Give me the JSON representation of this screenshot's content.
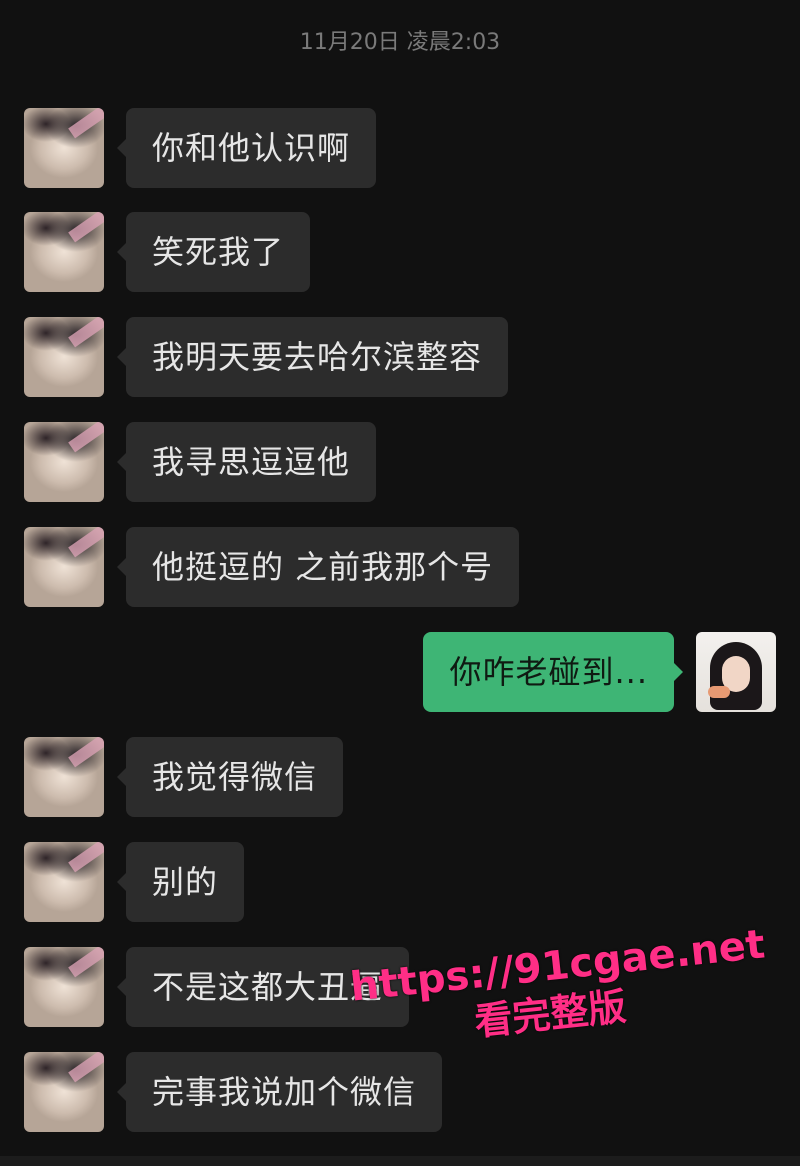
{
  "header": {
    "timestamp": "11月20日 凌晨2:03"
  },
  "messages": [
    {
      "sender": "them",
      "text": "你和他认识啊"
    },
    {
      "sender": "them",
      "text": "笑死我了"
    },
    {
      "sender": "them",
      "text": "我明天要去哈尔滨整容"
    },
    {
      "sender": "them",
      "text": "我寻思逗逗他"
    },
    {
      "sender": "them",
      "text": "他挺逗的 之前我那个号"
    },
    {
      "sender": "me",
      "text": "你咋老碰到..."
    },
    {
      "sender": "them",
      "text": "我觉得微信"
    },
    {
      "sender": "them",
      "text": "别的"
    },
    {
      "sender": "them",
      "text": "不是这都大丑逼"
    },
    {
      "sender": "them",
      "text": "完事我说加个微信"
    }
  ],
  "watermark": {
    "url": "https://91cgae.net",
    "subtitle": "看完整版",
    "color": "#ff2e86"
  },
  "colors": {
    "background": "#111111",
    "incoming_bubble": "#2c2c2c",
    "outgoing_bubble": "#3eb575"
  }
}
